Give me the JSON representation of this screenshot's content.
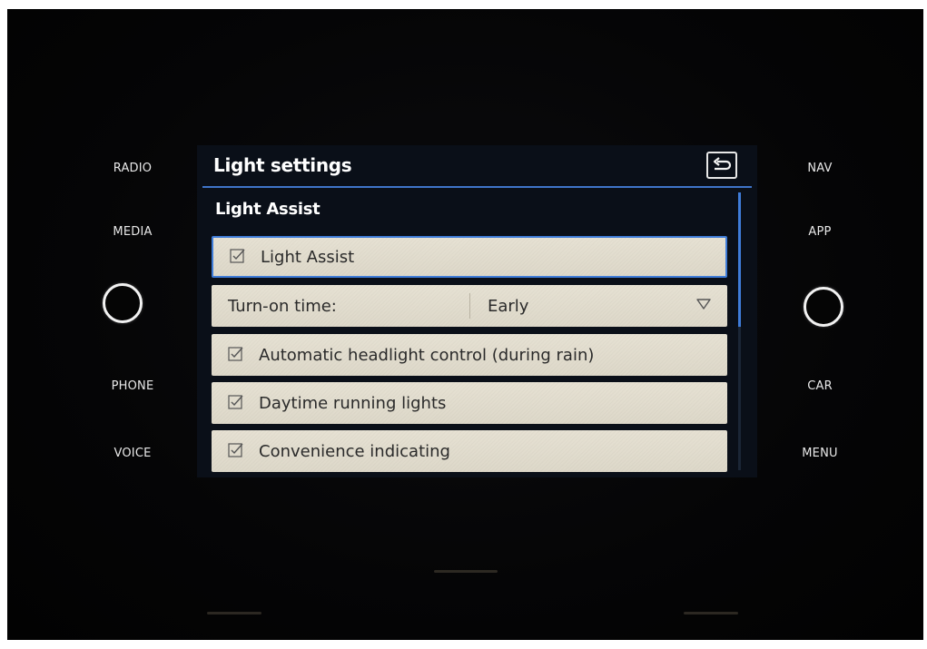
{
  "hardware_buttons": {
    "left": [
      "RADIO",
      "MEDIA",
      "PHONE",
      "VOICE"
    ],
    "right": [
      "NAV",
      "APP",
      "CAR",
      "MENU"
    ]
  },
  "screen": {
    "title": "Light settings",
    "section": "Light Assist",
    "rows": {
      "light_assist": {
        "label": "Light Assist",
        "checked": true
      },
      "turn_on_time": {
        "label": "Turn-on time:",
        "value": "Early"
      },
      "auto_headlight": {
        "label": "Automatic headlight control (during rain)",
        "checked": true
      },
      "daytime_running": {
        "label": "Daytime running lights",
        "checked": true
      },
      "convenience_indicating": {
        "label": "Convenience indicating",
        "checked": true
      }
    }
  },
  "icons": {
    "back": "back-arrow-icon",
    "checkbox": "checkbox-checked-icon",
    "dropdown": "triangle-down-icon",
    "knob": "rotary-knob-icon"
  },
  "colors": {
    "accent": "#3f7cd8",
    "row_bg": "#e2ddcf",
    "screen_bg": "#0a0f18"
  }
}
